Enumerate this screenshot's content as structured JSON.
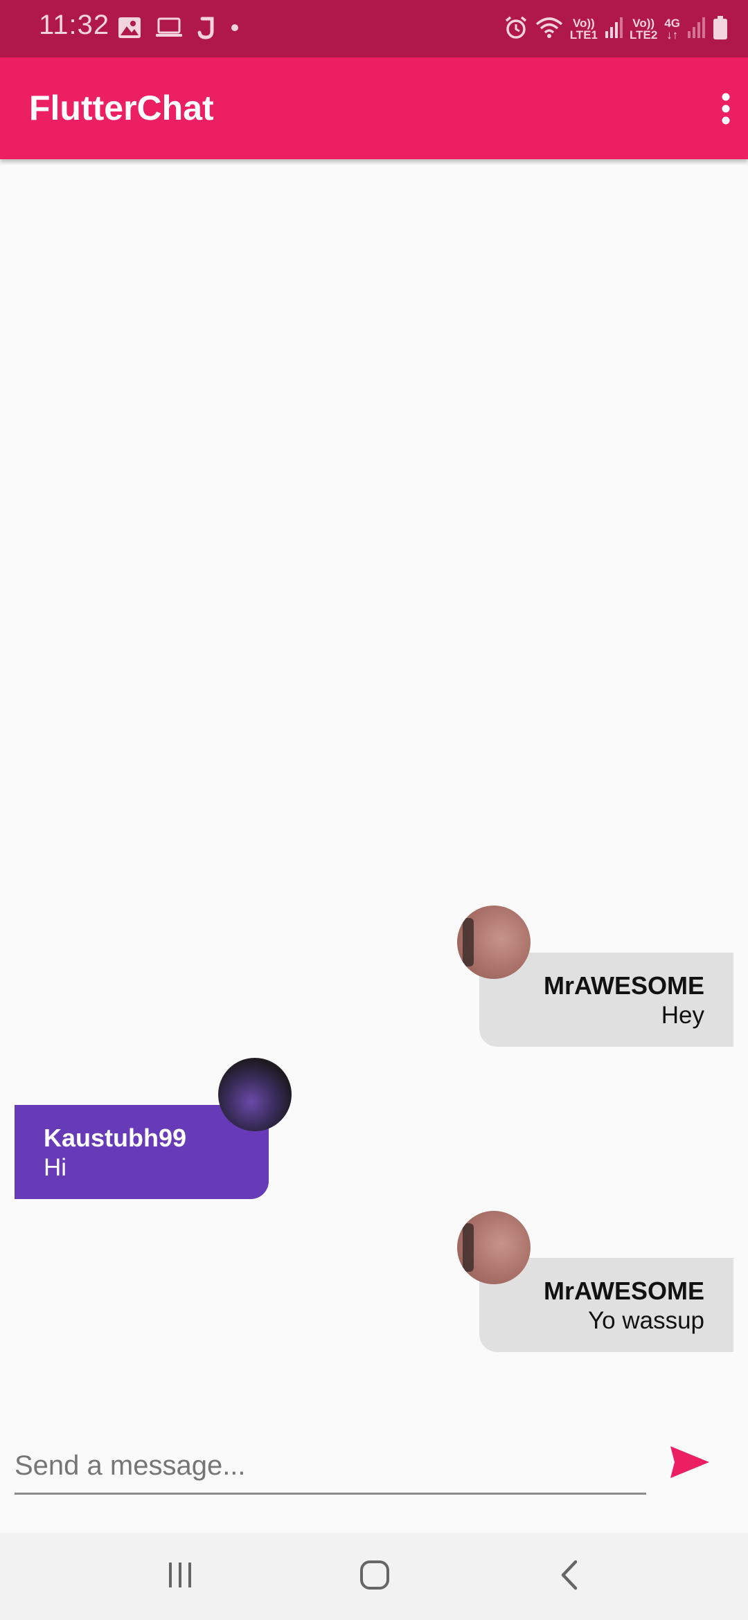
{
  "status_bar": {
    "time": "11:32",
    "sim1_top": "Vo))",
    "sim1_bottom": "LTE1",
    "sim2_top": "Vo))",
    "sim2_bottom": "LTE2",
    "network": "4G",
    "icons": [
      "image-icon",
      "laptop-icon",
      "j-app-icon",
      "dot-icon",
      "alarm-icon",
      "wifi-icon",
      "signal-icon",
      "signal-icon",
      "battery-icon"
    ]
  },
  "app_bar": {
    "title": "FlutterChat",
    "menu_icon": "more-vert-icon",
    "color": "#ec1f63"
  },
  "messages": [
    {
      "username": "MrAWESOME",
      "text": "Hey",
      "is_me": true
    },
    {
      "username": "Kaustubh99",
      "text": "Hi",
      "is_me": false
    },
    {
      "username": "MrAWESOME",
      "text": "Yo wassup",
      "is_me": true
    }
  ],
  "composer": {
    "placeholder": "Send a message...",
    "value": "",
    "send_icon": "send-icon",
    "send_color": "#ec1f63"
  },
  "nav_bar": {
    "icons": [
      "recent-apps-icon",
      "home-icon",
      "back-icon"
    ]
  },
  "colors": {
    "status_bar": "#b0174a",
    "my_bubble": "#e0e0e0",
    "their_bubble": "#673ab7"
  }
}
